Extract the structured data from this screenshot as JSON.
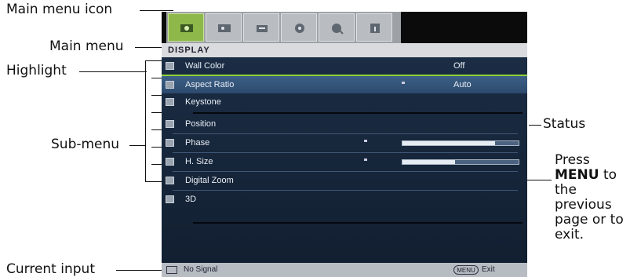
{
  "annotations": {
    "main_menu_icon": "Main menu icon",
    "main_menu": "Main menu",
    "highlight": "Highlight",
    "sub_menu": "Sub-menu",
    "status": "Status",
    "press": "Press",
    "menu_key": "MENU",
    "to": " to",
    "press_rest": [
      "the",
      "previous",
      "page or to",
      "exit."
    ],
    "current_input": "Current input"
  },
  "osd": {
    "tabs": [
      {
        "name": "display-tab",
        "icon": "display-icon",
        "active": true
      },
      {
        "name": "picture-tab",
        "icon": "picture-icon",
        "active": false
      },
      {
        "name": "source-tab",
        "icon": "source-icon",
        "active": false
      },
      {
        "name": "system-setup-basic-tab",
        "icon": "system-setup-icon",
        "active": false
      },
      {
        "name": "system-setup-advanced-tab",
        "icon": "advanced-setup-icon",
        "active": false
      },
      {
        "name": "information-tab",
        "icon": "information-icon",
        "active": false
      }
    ],
    "menu_title": "DISPLAY",
    "items": [
      {
        "label": "Wall Color",
        "value": "Off"
      },
      {
        "label": "Aspect Ratio",
        "value": "Auto"
      },
      {
        "label": "Keystone",
        "value": ""
      },
      {
        "label": "Position",
        "value": ""
      },
      {
        "label": "Phase",
        "value": "",
        "level": 0.8
      },
      {
        "label": "H. Size",
        "value": "",
        "level": 0.45
      },
      {
        "label": "Digital Zoom",
        "value": ""
      },
      {
        "label": "3D",
        "value": ""
      }
    ],
    "status_bar": {
      "input": "No Signal",
      "menu_key": "MENU",
      "exit": "Exit"
    }
  },
  "colors": {
    "active_tab": "#8fb84a",
    "highlight_line": "#8fd23a",
    "osd_bg": "#0f1c2e"
  }
}
